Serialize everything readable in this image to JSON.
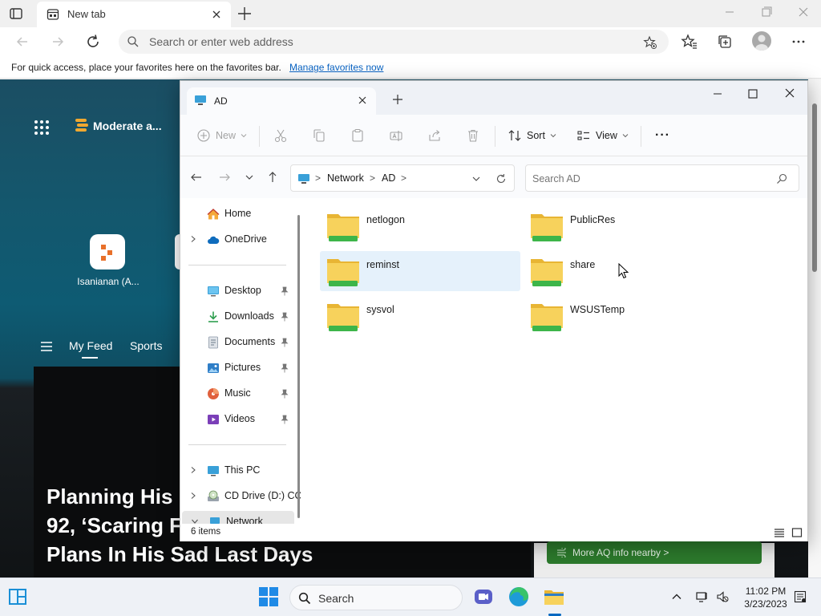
{
  "browser": {
    "tab_title": "New tab",
    "address_placeholder": "Search or enter web address",
    "favorites_bar_text": "For quick access, place your favorites here on the favorites bar.",
    "favorites_bar_link": "Manage favorites now"
  },
  "newtab": {
    "weather_label": "Moderate a...",
    "quicklink_label": "Isanianan (A...",
    "feed_tabs": [
      "My Feed",
      "Sports"
    ],
    "headline": "Planning His ... 92, ‘Scaring F... Plans In His Sad Last Days",
    "headline_lines": [
      "Planning His",
      "92, ‘Scaring F",
      "Plans In His Sad Last Days"
    ],
    "aq_button": "More AQ info nearby",
    "aq_arrow": ">"
  },
  "explorer": {
    "tab_title": "AD",
    "commands": {
      "new": "New",
      "sort": "Sort",
      "view": "View",
      "more": "···"
    },
    "breadcrumb": [
      "Network",
      "AD"
    ],
    "breadcrumb_sep": ">",
    "search_placeholder": "Search AD",
    "sidebar": {
      "home": "Home",
      "onedrive": "OneDrive",
      "desktop": "Desktop",
      "downloads": "Downloads",
      "documents": "Documents",
      "pictures": "Pictures",
      "music": "Music",
      "videos": "Videos",
      "thispc": "This PC",
      "cddrive": "CD Drive (D:) CC",
      "network": "Network"
    },
    "folders": [
      "netlogon",
      "PublicRes",
      "reminst",
      "share",
      "sysvol",
      "WSUSTemp"
    ],
    "status_count": "6 items"
  },
  "taskbar": {
    "search_label": "Search",
    "time": "11:02 PM",
    "date": "3/23/2023"
  },
  "colors": {
    "accent": "#0067c0",
    "folder_yellow": "#f7d25c",
    "folder_green": "#3db54a",
    "hover_blue": "#e5f1fb"
  }
}
